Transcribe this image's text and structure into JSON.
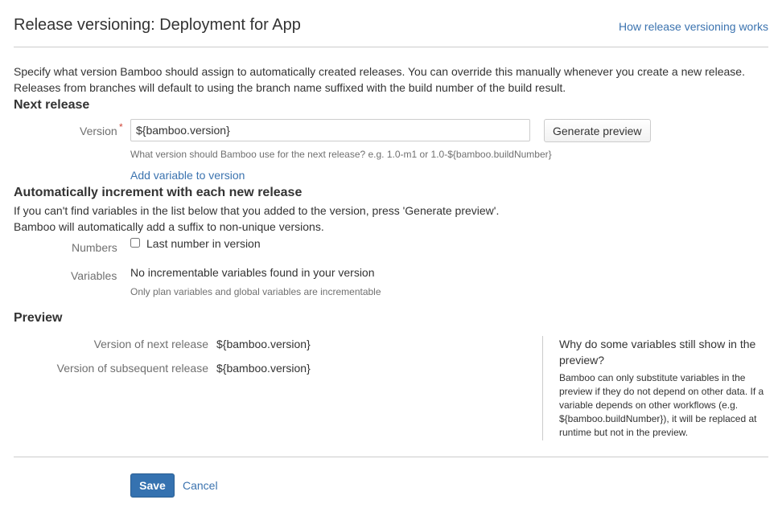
{
  "header": {
    "title": "Release versioning: Deployment for App",
    "help_link": "How release versioning works"
  },
  "intro": {
    "line1": "Specify what version Bamboo should assign to automatically created releases. You can override this manually whenever you create a new release.",
    "line2": "Releases from branches will default to using the branch name suffixed with the build number of the build result."
  },
  "next_release": {
    "heading": "Next release",
    "version_label": "Version",
    "required_mark": "*",
    "version_value": "${bamboo.version}",
    "generate_preview_label": "Generate preview",
    "help_text": "What version should Bamboo use for the next release? e.g. 1.0-m1 or 1.0-${bamboo.buildNumber}",
    "add_variable_link": "Add variable to version"
  },
  "auto_increment": {
    "heading": "Automatically increment with each new release",
    "desc1": "If you can't find variables in the list below that you added to the version, press 'Generate preview'.",
    "desc2": "Bamboo will automatically add a suffix to non-unique versions.",
    "numbers_label": "Numbers",
    "numbers_checkbox_label": "Last number in version",
    "numbers_checked": false,
    "variables_label": "Variables",
    "variables_value": "No incrementable variables found in your version",
    "variables_help": "Only plan variables and global variables are incrementable"
  },
  "preview": {
    "heading": "Preview",
    "next_label": "Version of next release",
    "next_value": "${bamboo.version}",
    "subsequent_label": "Version of subsequent release",
    "subsequent_value": "${bamboo.version}",
    "side_title": "Why do some variables still show in the preview?",
    "side_body": "Bamboo can only substitute variables in the preview if they do not depend on other data. If a variable depends on other workflows (e.g. ${bamboo.buildNumber}), it will be replaced at runtime but not in the preview."
  },
  "actions": {
    "save_label": "Save",
    "cancel_label": "Cancel"
  }
}
